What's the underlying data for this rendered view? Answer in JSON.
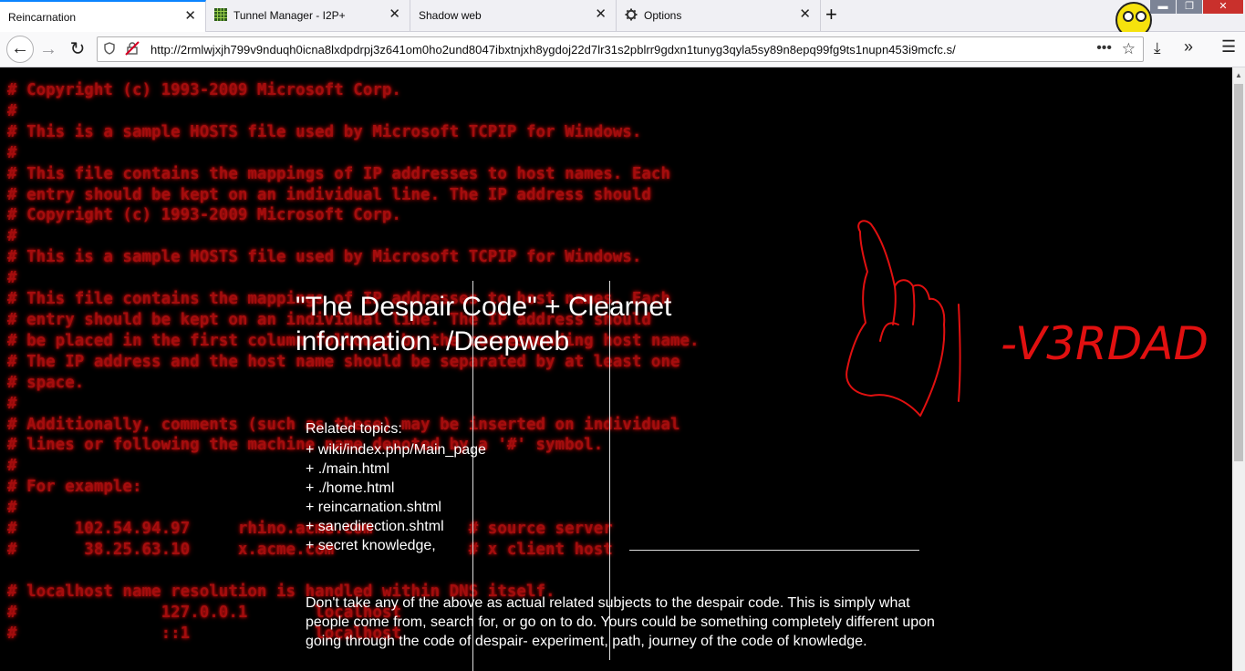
{
  "tabs": [
    {
      "title": "Reincarnation",
      "icon": "",
      "active": true
    },
    {
      "title": "Tunnel Manager - I2P+",
      "icon": "grid-favicon-icon"
    },
    {
      "title": "Shadow web",
      "icon": ""
    },
    {
      "title": "Options",
      "icon": "gear-icon"
    }
  ],
  "tab_close_glyph": "✕",
  "new_tab_glyph": "+",
  "window_controls": {
    "minimize": "▬",
    "maximize": "❐",
    "close": "✕"
  },
  "nav": {
    "back_glyph": "←",
    "forward_glyph": "→",
    "reload_glyph": "↻",
    "url": "http://2rmlwjxjh799v9nduqh0icna8lxdpdrpj3z641om0ho2und8047ibxtnjxh8ygdoj22d7lr31s2pblrr9gdxn1tunyg3qyla5sy89n8epq99fg9ts1nupn453i9mcfc.s/",
    "page_actions_glyph": "•••",
    "bookmark_glyph": "☆",
    "library_glyph": "⤓",
    "overflow_glyph": "»",
    "menu_glyph": "☰"
  },
  "background_hosts_text": "# Copyright (c) 1993-2009 Microsoft Corp.\n#\n# This is a sample HOSTS file used by Microsoft TCPIP for Windows.\n#\n# This file contains the mappings of IP addresses to host names. Each\n# entry should be kept on an individual line. The IP address should\n# Copyright (c) 1993-2009 Microsoft Corp.\n#\n# This is a sample HOSTS file used by Microsoft TCPIP for Windows.\n#\n# This file contains the mappings of IP addresses to host names. Each\n# entry should be kept on an individual line. The IP address should\n# be placed in the first column followed by the corresponding host name.\n# The IP address and the host name should be separated by at least one\n# space.\n#\n# Additionally, comments (such as these) may be inserted on individual\n# lines or following the machine name denoted by a '#' symbol.\n#\n# For example:\n#\n#      102.54.94.97     rhino.acme.com          # source server\n#       38.25.63.10     x.acme.com              # x client host\n\n# localhost name resolution is handled within DNS itself.\n#\t\t127.0.0.1       localhost\n#\t\t::1             localhost",
  "page": {
    "title": "\"The Despair Code\" + Clearnet information. /Deepweb",
    "related_heading": "Related topics:",
    "related_topics": [
      "+ wiki/index.php/Main_page",
      "+ ./main.html",
      "+ ./home.html",
      "+ reincarnation.shtml",
      "+ sanedirection.shtml",
      "+ secret knowledge,"
    ],
    "notice": "Don't take any of the above as actual related subjects to the despair code. This is simply what people come from, search for, or go on to do. Yours could be something completely different upon going through the code of despair- experiment, path, journey of the code of knowledge."
  },
  "signature": "-V3RDAD",
  "colors": {
    "background": "#000000",
    "code_red": "#b20f0f",
    "scribble_red": "#e01010",
    "text": "#ffffff",
    "tab_accent": "#0a84ff"
  }
}
